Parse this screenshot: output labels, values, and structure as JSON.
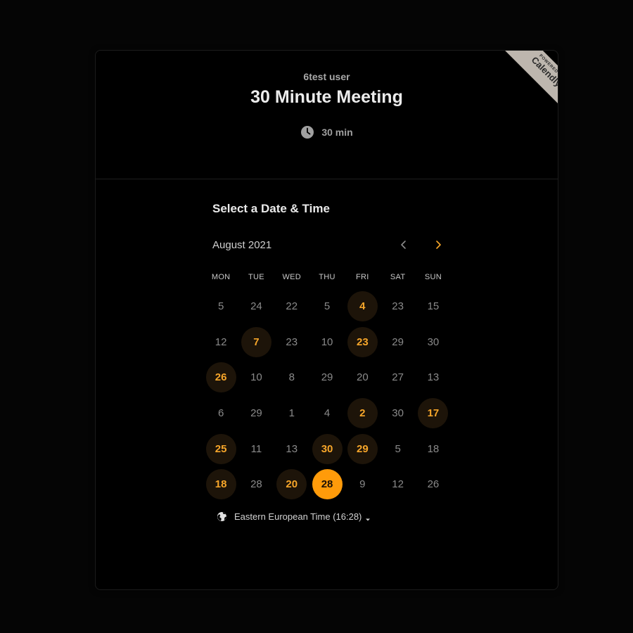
{
  "header": {
    "owner": "6test user",
    "title": "30 Minute Meeting",
    "duration": "30 min",
    "duration_icon": "clock-icon"
  },
  "ribbon": {
    "powered_by": "POWERED BY",
    "brand": "Calendly"
  },
  "calendar": {
    "section_title": "Select a Date & Time",
    "month": "August 2021",
    "prev_icon": "chevron-left-icon",
    "next_icon": "chevron-right-icon",
    "weekdays": [
      "MON",
      "TUE",
      "WED",
      "THU",
      "FRI",
      "SAT",
      "SUN"
    ],
    "days": [
      {
        "label": "5",
        "state": "disabled"
      },
      {
        "label": "24",
        "state": "disabled"
      },
      {
        "label": "22",
        "state": "disabled"
      },
      {
        "label": "5",
        "state": "disabled"
      },
      {
        "label": "4",
        "state": "available"
      },
      {
        "label": "23",
        "state": "disabled"
      },
      {
        "label": "15",
        "state": "disabled"
      },
      {
        "label": "12",
        "state": "disabled"
      },
      {
        "label": "7",
        "state": "available"
      },
      {
        "label": "23",
        "state": "disabled"
      },
      {
        "label": "10",
        "state": "disabled"
      },
      {
        "label": "23",
        "state": "available"
      },
      {
        "label": "29",
        "state": "disabled"
      },
      {
        "label": "30",
        "state": "disabled"
      },
      {
        "label": "26",
        "state": "available"
      },
      {
        "label": "10",
        "state": "disabled"
      },
      {
        "label": "8",
        "state": "disabled"
      },
      {
        "label": "29",
        "state": "disabled"
      },
      {
        "label": "20",
        "state": "disabled"
      },
      {
        "label": "27",
        "state": "disabled"
      },
      {
        "label": "13",
        "state": "disabled"
      },
      {
        "label": "6",
        "state": "disabled"
      },
      {
        "label": "29",
        "state": "disabled"
      },
      {
        "label": "1",
        "state": "disabled"
      },
      {
        "label": "4",
        "state": "disabled"
      },
      {
        "label": "2",
        "state": "available"
      },
      {
        "label": "30",
        "state": "disabled"
      },
      {
        "label": "17",
        "state": "available"
      },
      {
        "label": "25",
        "state": "available"
      },
      {
        "label": "11",
        "state": "disabled"
      },
      {
        "label": "13",
        "state": "disabled"
      },
      {
        "label": "30",
        "state": "available"
      },
      {
        "label": "29",
        "state": "available"
      },
      {
        "label": "5",
        "state": "disabled"
      },
      {
        "label": "18",
        "state": "disabled"
      },
      {
        "label": "18",
        "state": "available"
      },
      {
        "label": "28",
        "state": "disabled"
      },
      {
        "label": "20",
        "state": "available"
      },
      {
        "label": "28",
        "state": "selected"
      },
      {
        "label": "9",
        "state": "disabled"
      },
      {
        "label": "12",
        "state": "disabled"
      },
      {
        "label": "26",
        "state": "disabled"
      }
    ]
  },
  "timezone": {
    "label": "Eastern European Time (16:28)",
    "icon": "globe-icon",
    "caret_icon": "caret-down-icon"
  },
  "colors": {
    "accent": "#ff9b0a",
    "available_text": "#f7a62a",
    "available_bg": "#1d1409",
    "ribbon": "#bdb6ae",
    "background": "#000000"
  }
}
